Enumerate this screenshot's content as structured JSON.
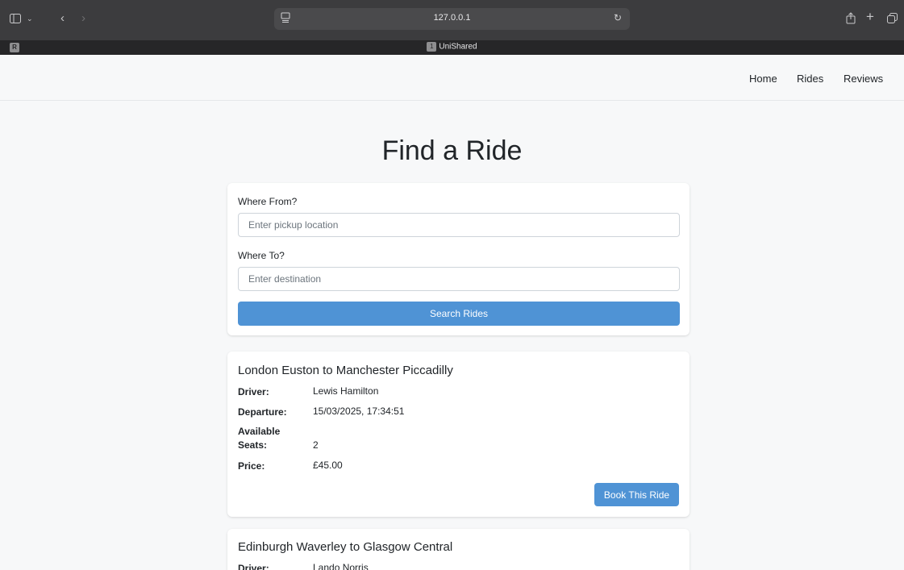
{
  "browser": {
    "url": "127.0.0.1",
    "tab_left_badge": "R",
    "tab_badge": "1",
    "tab_title": "UniShared"
  },
  "nav": {
    "items": [
      {
        "label": "Home"
      },
      {
        "label": "Rides"
      },
      {
        "label": "Reviews"
      }
    ]
  },
  "page": {
    "title": "Find a Ride"
  },
  "search": {
    "from_label": "Where From?",
    "from_placeholder": "Enter pickup location",
    "to_label": "Where To?",
    "to_placeholder": "Enter destination",
    "button_label": "Search Rides"
  },
  "labels": {
    "driver": "Driver:",
    "departure": "Departure:",
    "available": "Available",
    "seats": "Seats:",
    "price": "Price:",
    "book": "Book This Ride"
  },
  "rides": [
    {
      "title": "London Euston to Manchester Piccadilly",
      "driver": "Lewis Hamilton",
      "departure": "15/03/2025, 17:34:51",
      "seats": "2",
      "price": "£45.00"
    },
    {
      "title": "Edinburgh Waverley to Glasgow Central",
      "driver": "Lando Norris"
    }
  ],
  "colors": {
    "primary_button": "#4f93d5",
    "page_bg": "#f7f8f9",
    "chrome_bg": "#3c3c3e"
  }
}
